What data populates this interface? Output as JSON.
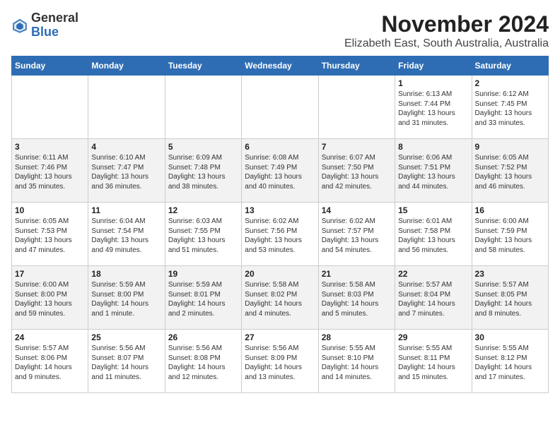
{
  "header": {
    "logo_general": "General",
    "logo_blue": "Blue",
    "title": "November 2024",
    "subtitle": "Elizabeth East, South Australia, Australia"
  },
  "weekdays": [
    "Sunday",
    "Monday",
    "Tuesday",
    "Wednesday",
    "Thursday",
    "Friday",
    "Saturday"
  ],
  "weeks": [
    [
      {
        "day": "",
        "info": ""
      },
      {
        "day": "",
        "info": ""
      },
      {
        "day": "",
        "info": ""
      },
      {
        "day": "",
        "info": ""
      },
      {
        "day": "",
        "info": ""
      },
      {
        "day": "1",
        "info": "Sunrise: 6:13 AM\nSunset: 7:44 PM\nDaylight: 13 hours\nand 31 minutes."
      },
      {
        "day": "2",
        "info": "Sunrise: 6:12 AM\nSunset: 7:45 PM\nDaylight: 13 hours\nand 33 minutes."
      }
    ],
    [
      {
        "day": "3",
        "info": "Sunrise: 6:11 AM\nSunset: 7:46 PM\nDaylight: 13 hours\nand 35 minutes."
      },
      {
        "day": "4",
        "info": "Sunrise: 6:10 AM\nSunset: 7:47 PM\nDaylight: 13 hours\nand 36 minutes."
      },
      {
        "day": "5",
        "info": "Sunrise: 6:09 AM\nSunset: 7:48 PM\nDaylight: 13 hours\nand 38 minutes."
      },
      {
        "day": "6",
        "info": "Sunrise: 6:08 AM\nSunset: 7:49 PM\nDaylight: 13 hours\nand 40 minutes."
      },
      {
        "day": "7",
        "info": "Sunrise: 6:07 AM\nSunset: 7:50 PM\nDaylight: 13 hours\nand 42 minutes."
      },
      {
        "day": "8",
        "info": "Sunrise: 6:06 AM\nSunset: 7:51 PM\nDaylight: 13 hours\nand 44 minutes."
      },
      {
        "day": "9",
        "info": "Sunrise: 6:05 AM\nSunset: 7:52 PM\nDaylight: 13 hours\nand 46 minutes."
      }
    ],
    [
      {
        "day": "10",
        "info": "Sunrise: 6:05 AM\nSunset: 7:53 PM\nDaylight: 13 hours\nand 47 minutes."
      },
      {
        "day": "11",
        "info": "Sunrise: 6:04 AM\nSunset: 7:54 PM\nDaylight: 13 hours\nand 49 minutes."
      },
      {
        "day": "12",
        "info": "Sunrise: 6:03 AM\nSunset: 7:55 PM\nDaylight: 13 hours\nand 51 minutes."
      },
      {
        "day": "13",
        "info": "Sunrise: 6:02 AM\nSunset: 7:56 PM\nDaylight: 13 hours\nand 53 minutes."
      },
      {
        "day": "14",
        "info": "Sunrise: 6:02 AM\nSunset: 7:57 PM\nDaylight: 13 hours\nand 54 minutes."
      },
      {
        "day": "15",
        "info": "Sunrise: 6:01 AM\nSunset: 7:58 PM\nDaylight: 13 hours\nand 56 minutes."
      },
      {
        "day": "16",
        "info": "Sunrise: 6:00 AM\nSunset: 7:59 PM\nDaylight: 13 hours\nand 58 minutes."
      }
    ],
    [
      {
        "day": "17",
        "info": "Sunrise: 6:00 AM\nSunset: 8:00 PM\nDaylight: 13 hours\nand 59 minutes."
      },
      {
        "day": "18",
        "info": "Sunrise: 5:59 AM\nSunset: 8:00 PM\nDaylight: 14 hours\nand 1 minute."
      },
      {
        "day": "19",
        "info": "Sunrise: 5:59 AM\nSunset: 8:01 PM\nDaylight: 14 hours\nand 2 minutes."
      },
      {
        "day": "20",
        "info": "Sunrise: 5:58 AM\nSunset: 8:02 PM\nDaylight: 14 hours\nand 4 minutes."
      },
      {
        "day": "21",
        "info": "Sunrise: 5:58 AM\nSunset: 8:03 PM\nDaylight: 14 hours\nand 5 minutes."
      },
      {
        "day": "22",
        "info": "Sunrise: 5:57 AM\nSunset: 8:04 PM\nDaylight: 14 hours\nand 7 minutes."
      },
      {
        "day": "23",
        "info": "Sunrise: 5:57 AM\nSunset: 8:05 PM\nDaylight: 14 hours\nand 8 minutes."
      }
    ],
    [
      {
        "day": "24",
        "info": "Sunrise: 5:57 AM\nSunset: 8:06 PM\nDaylight: 14 hours\nand 9 minutes."
      },
      {
        "day": "25",
        "info": "Sunrise: 5:56 AM\nSunset: 8:07 PM\nDaylight: 14 hours\nand 11 minutes."
      },
      {
        "day": "26",
        "info": "Sunrise: 5:56 AM\nSunset: 8:08 PM\nDaylight: 14 hours\nand 12 minutes."
      },
      {
        "day": "27",
        "info": "Sunrise: 5:56 AM\nSunset: 8:09 PM\nDaylight: 14 hours\nand 13 minutes."
      },
      {
        "day": "28",
        "info": "Sunrise: 5:55 AM\nSunset: 8:10 PM\nDaylight: 14 hours\nand 14 minutes."
      },
      {
        "day": "29",
        "info": "Sunrise: 5:55 AM\nSunset: 8:11 PM\nDaylight: 14 hours\nand 15 minutes."
      },
      {
        "day": "30",
        "info": "Sunrise: 5:55 AM\nSunset: 8:12 PM\nDaylight: 14 hours\nand 17 minutes."
      }
    ]
  ]
}
